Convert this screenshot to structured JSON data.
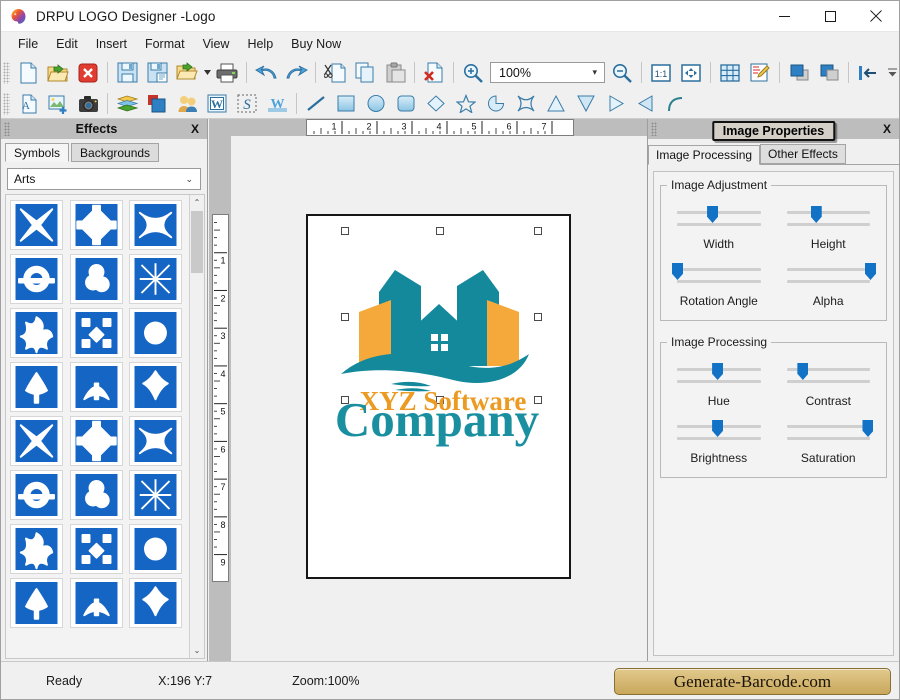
{
  "window": {
    "title": "DRPU LOGO Designer -Logo",
    "app_icon": "palette-icon",
    "minimize": "—",
    "maximize": "☐",
    "close": "✕"
  },
  "menubar": {
    "items": [
      {
        "label": "File",
        "name": "menu-file"
      },
      {
        "label": "Edit",
        "name": "menu-edit"
      },
      {
        "label": "Insert",
        "name": "menu-insert"
      },
      {
        "label": "Format",
        "name": "menu-format"
      },
      {
        "label": "View",
        "name": "menu-view"
      },
      {
        "label": "Help",
        "name": "menu-help"
      },
      {
        "label": "Buy Now",
        "name": "menu-buy-now"
      }
    ]
  },
  "toolbar_main": {
    "zoom_value": "100%",
    "zoom_arrow": "▾",
    "overflow": "▾",
    "buttons": [
      {
        "name": "new-document-icon",
        "icon": "new"
      },
      {
        "name": "open-folder-icon",
        "icon": "open"
      },
      {
        "name": "close-document-icon",
        "icon": "closedoc"
      },
      {
        "name": "save-icon",
        "icon": "save"
      },
      {
        "name": "save-as-icon",
        "icon": "saveas"
      },
      {
        "name": "import-icon",
        "icon": "import"
      },
      {
        "name": "print-icon",
        "icon": "print"
      },
      {
        "name": "undo-icon",
        "icon": "undo"
      },
      {
        "name": "redo-icon",
        "icon": "redo"
      },
      {
        "name": "cut-icon",
        "icon": "cut"
      },
      {
        "name": "copy-icon",
        "icon": "copy"
      },
      {
        "name": "paste-icon",
        "icon": "paste"
      },
      {
        "name": "delete-icon",
        "icon": "delete"
      },
      {
        "name": "zoom-in-icon",
        "icon": "zoomin"
      },
      {
        "name": "zoom-out-icon",
        "icon": "zoomout"
      },
      {
        "name": "actual-size-icon",
        "icon": "onetoone"
      },
      {
        "name": "fit-page-icon",
        "icon": "fitpage"
      },
      {
        "name": "grid-icon",
        "icon": "grid"
      },
      {
        "name": "edit-page-icon",
        "icon": "editpage"
      },
      {
        "name": "bring-front-icon",
        "icon": "front"
      },
      {
        "name": "send-back-icon",
        "icon": "back"
      },
      {
        "name": "align-left-icon",
        "icon": "alignleft"
      }
    ]
  },
  "toolbar_shapes": {
    "buttons": [
      {
        "name": "add-text-icon",
        "icon": "text"
      },
      {
        "name": "add-image-icon",
        "icon": "image"
      },
      {
        "name": "capture-icon",
        "icon": "camera"
      },
      {
        "name": "layers-icon",
        "icon": "layers"
      },
      {
        "name": "shapes-stack-icon",
        "icon": "stack"
      },
      {
        "name": "clipart-icon",
        "icon": "people"
      },
      {
        "name": "word-art-icon",
        "icon": "word"
      },
      {
        "name": "signature-icon",
        "icon": "signature"
      },
      {
        "name": "watermark-icon",
        "icon": "watermark"
      },
      {
        "name": "line-tool-icon",
        "icon": "line"
      },
      {
        "name": "rectangle-tool-icon",
        "icon": "rect"
      },
      {
        "name": "ellipse-tool-icon",
        "icon": "ellipse"
      },
      {
        "name": "rounded-rect-tool-icon",
        "icon": "roundrect"
      },
      {
        "name": "diamond-tool-icon",
        "icon": "diamond"
      },
      {
        "name": "star-tool-icon",
        "icon": "star"
      },
      {
        "name": "pie-tool-icon",
        "icon": "pie"
      },
      {
        "name": "four-point-star-tool-icon",
        "icon": "star4"
      },
      {
        "name": "triangle-up-tool-icon",
        "icon": "triup"
      },
      {
        "name": "triangle-down-tool-icon",
        "icon": "tridown"
      },
      {
        "name": "triangle-right-tool-icon",
        "icon": "triright"
      },
      {
        "name": "triangle-left-tool-icon",
        "icon": "trileft"
      },
      {
        "name": "arc-tool-icon",
        "icon": "arc"
      }
    ]
  },
  "left_panel": {
    "title": "Effects",
    "close_label": "X",
    "tabs": [
      {
        "label": "Symbols",
        "active": true
      },
      {
        "label": "Backgrounds",
        "active": false
      }
    ],
    "category": {
      "value": "Arts",
      "arrow": "⌄"
    },
    "scroll": {
      "up": "⌃",
      "down": "⌄"
    },
    "symbols": [
      "sym-knot-square",
      "sym-cross-diamond",
      "sym-interlace-x",
      "sym-double-loop",
      "sym-triquetra",
      "sym-circle-weave",
      "sym-clover-swirl",
      "sym-node-dots",
      "sym-spiral-trio",
      "sym-tulip",
      "sym-wave-leaf",
      "sym-leaf-star",
      "sym-diamond-drop",
      "sym-fan-leaf",
      "sym-palm-leaf",
      "sym-fan-diamond",
      "sym-oak-tree",
      "sym-triskele",
      "sym-rosette",
      "sym-scroll-knot",
      "sym-globe-grid",
      "sym-quatrefoil",
      "sym-arch-lines",
      "sym-trispiral"
    ]
  },
  "canvas": {
    "h_ruler_ticks": [
      "1",
      "2",
      "3",
      "4",
      "5",
      "6",
      "7"
    ],
    "v_ruler_ticks": [
      "1",
      "2",
      "3",
      "4",
      "5",
      "6",
      "7",
      "8",
      "9"
    ],
    "logo": {
      "name": "xyz-software-company-logo",
      "text_line1": "XYZ Software",
      "text_line2": "Company",
      "color_teal": "#15899c",
      "color_orange": "#f5a93b",
      "color_text_orange": "#eb9a22"
    }
  },
  "right_panel": {
    "title": "Image Properties",
    "close_label": "X",
    "tabs": [
      {
        "label": "Image Processing",
        "active": true
      },
      {
        "label": "Other Effects",
        "active": false
      }
    ],
    "groups": [
      {
        "legend": "Image Adjustment",
        "sliders": [
          {
            "label": "Width",
            "value": 42
          },
          {
            "label": "Height",
            "value": 35
          },
          {
            "label": "Rotation Angle",
            "value": 0
          },
          {
            "label": "Alpha",
            "value": 100
          }
        ]
      },
      {
        "legend": "Image Processing",
        "sliders": [
          {
            "label": "Hue",
            "value": 48
          },
          {
            "label": "Contrast",
            "value": 19
          },
          {
            "label": "Brightness",
            "value": 48
          },
          {
            "label": "Saturation",
            "value": 97
          }
        ]
      }
    ]
  },
  "statusbar": {
    "ready": "Ready",
    "coords": "X:196  Y:7",
    "zoom": "Zoom:100%",
    "brand": "Generate-Barcode.com"
  }
}
